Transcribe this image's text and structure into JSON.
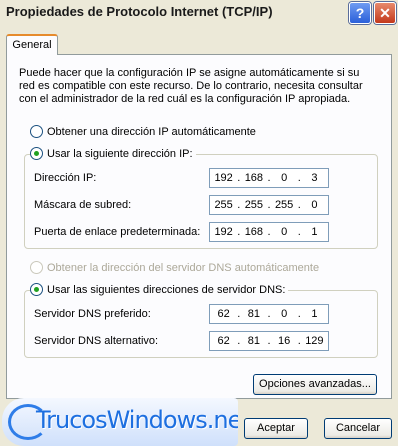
{
  "window": {
    "title": "Propiedades de Protocolo Internet (TCP/IP)"
  },
  "tabs": [
    {
      "label": "General"
    }
  ],
  "description": "Puede hacer que la configuración IP se asigne automáticamente si su red es compatible con este recurso. De lo contrario, necesita consultar con el administrador de la red cuál es la configuración IP apropiada.",
  "ip_section": {
    "auto_label": "Obtener una dirección IP automáticamente",
    "manual_label": "Usar la siguiente dirección IP:",
    "selected": "manual",
    "fields": [
      {
        "label": "Dirección IP:",
        "octets": [
          "192",
          "168",
          "0",
          "3"
        ]
      },
      {
        "label": "Máscara de subred:",
        "octets": [
          "255",
          "255",
          "255",
          "0"
        ]
      },
      {
        "label": "Puerta de enlace predeterminada:",
        "octets": [
          "192",
          "168",
          "0",
          "1"
        ]
      }
    ]
  },
  "dns_section": {
    "auto_label": "Obtener la dirección del servidor DNS automáticamente",
    "manual_label": "Usar las siguientes direcciones de servidor DNS:",
    "selected": "manual",
    "fields": [
      {
        "label": "Servidor DNS preferido:",
        "octets": [
          "62",
          "81",
          "0",
          "1"
        ]
      },
      {
        "label": "Servidor DNS alternativo:",
        "octets": [
          "62",
          "81",
          "16",
          "129"
        ]
      }
    ]
  },
  "buttons": {
    "advanced": "Opciones avanzadas...",
    "ok": "Aceptar",
    "cancel": "Cancelar"
  },
  "watermark": {
    "text": "TrucosWindows.net"
  },
  "colors": {
    "tab_accent": "#E68B2C",
    "radio_dot": "#21A121",
    "button_border": "#003C74"
  }
}
